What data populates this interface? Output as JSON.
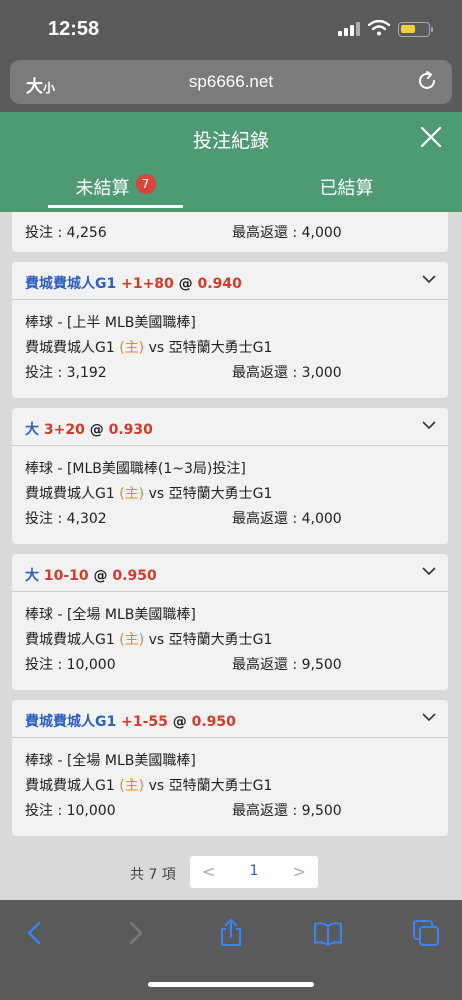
{
  "status": {
    "time": "12:58"
  },
  "browser": {
    "text_size_main": "大",
    "text_size_small": "小",
    "domain": "sp6666.net"
  },
  "modal": {
    "title": "投注紀錄"
  },
  "tabs": [
    {
      "label": "未結算",
      "badge": "7",
      "active": true
    },
    {
      "label": "已結算",
      "active": false
    }
  ],
  "partial": {
    "stake_label": "投注 : 4,256",
    "max_label": "最高返還 : 4,000"
  },
  "cards": [
    {
      "sel": "費城費城人G1",
      "line": "+1+80",
      "at": "@",
      "odds": "0.940",
      "sport": "棒球 - [上半 MLB美國職棒]",
      "home": "費城費城人G1",
      "home_tag": "(主)",
      "vs": "vs 亞特蘭大勇士G1",
      "stake": "投注 : 3,192",
      "max": "最高返還 : 3,000"
    },
    {
      "sel": "大",
      "line": "3+20",
      "at": "@",
      "odds": "0.930",
      "sport": "棒球 - [MLB美國職棒(1~3局)投注]",
      "home": "費城費城人G1",
      "home_tag": "(主)",
      "vs": "vs 亞特蘭大勇士G1",
      "stake": "投注 : 4,302",
      "max": "最高返還 : 4,000"
    },
    {
      "sel": "大",
      "line": "10-10",
      "at": "@",
      "odds": "0.950",
      "sport": "棒球 - [全場 MLB美國職棒]",
      "home": "費城費城人G1",
      "home_tag": "(主)",
      "vs": "vs 亞特蘭大勇士G1",
      "stake": "投注 : 10,000",
      "max": "最高返還 : 9,500"
    },
    {
      "sel": "費城費城人G1",
      "line": "+1-55",
      "at": "@",
      "odds": "0.950",
      "sport": "棒球 - [全場 MLB美國職棒]",
      "home": "費城費城人G1",
      "home_tag": "(主)",
      "vs": "vs 亞特蘭大勇士G1",
      "stake": "投注 : 10,000",
      "max": "最高返還 : 9,500"
    }
  ],
  "pager": {
    "total": "共 7 項",
    "page": "1",
    "prev": "<",
    "next": ">"
  },
  "icons": [
    "back-icon",
    "forward-icon",
    "share-icon",
    "bookmarks-icon",
    "tabs-icon"
  ]
}
